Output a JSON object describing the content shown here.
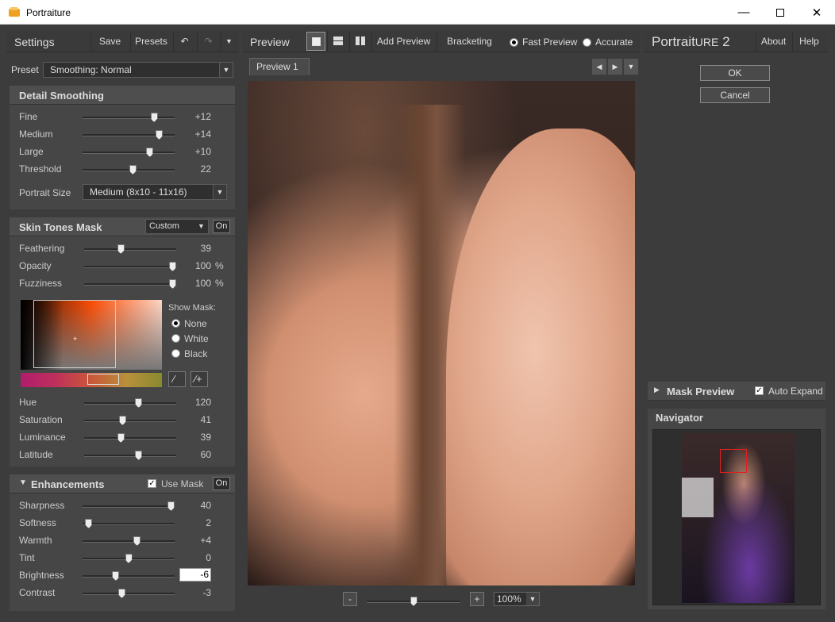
{
  "window": {
    "title": "Portraiture"
  },
  "settings": {
    "title": "Settings",
    "save_label": "Save",
    "presets_label": "Presets",
    "preset_label": "Preset",
    "preset_value": "Smoothing: Normal"
  },
  "detail": {
    "title": "Detail Smoothing",
    "sliders": [
      {
        "label": "Fine",
        "value": "+12",
        "pos": 0.8
      },
      {
        "label": "Medium",
        "value": "+14",
        "pos": 0.86
      },
      {
        "label": "Large",
        "value": "+10",
        "pos": 0.75
      },
      {
        "label": "Threshold",
        "value": "22",
        "pos": 0.55
      }
    ],
    "portrait_size_label": "Portrait Size",
    "portrait_size_value": "Medium (8x10 - 11x16)"
  },
  "skin": {
    "title": "Skin Tones Mask",
    "mode_value": "Custom",
    "on_label": "On",
    "sliders": [
      {
        "label": "Feathering",
        "value": "39",
        "unit": "",
        "pos": 0.39
      },
      {
        "label": "Opacity",
        "value": "100",
        "unit": "%",
        "pos": 1.0
      },
      {
        "label": "Fuzziness",
        "value": "100",
        "unit": "%",
        "pos": 1.0
      }
    ],
    "show_mask_label": "Show Mask:",
    "mask_options": [
      "None",
      "White",
      "Black"
    ],
    "hue_sliders": [
      {
        "label": "Hue",
        "value": "120",
        "pos": 0.6
      },
      {
        "label": "Saturation",
        "value": "41",
        "pos": 0.41
      },
      {
        "label": "Luminance",
        "value": "39",
        "pos": 0.39
      },
      {
        "label": "Latitude",
        "value": "60",
        "pos": 0.6
      }
    ]
  },
  "enh": {
    "title": "Enhancements",
    "use_mask_label": "Use Mask",
    "on_label": "On",
    "sliders": [
      {
        "label": "Sharpness",
        "value": "40",
        "pos": 1.0
      },
      {
        "label": "Softness",
        "value": "2",
        "pos": 0.03
      },
      {
        "label": "Warmth",
        "value": "+4",
        "pos": 0.6
      },
      {
        "label": "Tint",
        "value": "0",
        "pos": 0.5
      },
      {
        "label": "Brightness",
        "value": "-6",
        "pos": 0.35
      },
      {
        "label": "Contrast",
        "value": "-3",
        "pos": 0.42
      }
    ]
  },
  "preview": {
    "title": "Preview",
    "add_preview_label": "Add Preview",
    "bracketing_label": "Bracketing",
    "fast_preview_label": "Fast Preview",
    "accurate_label": "Accurate",
    "tab_label": "Preview 1",
    "zoom_minus": "-",
    "zoom_plus": "+",
    "zoom_value": "100%",
    "zoom_pos": 0.5
  },
  "right": {
    "brand_a": "Portrait",
    "brand_b": "ure",
    "brand_c": " 2",
    "about_label": "About",
    "help_label": "Help",
    "ok_label": "OK",
    "cancel_label": "Cancel",
    "mask_preview_label": "Mask Preview",
    "auto_expand_label": "Auto Expand",
    "navigator_label": "Navigator"
  },
  "colors": {
    "accent_red": "#e02020",
    "panel": "#464646",
    "dark": "#2c2c2c"
  }
}
